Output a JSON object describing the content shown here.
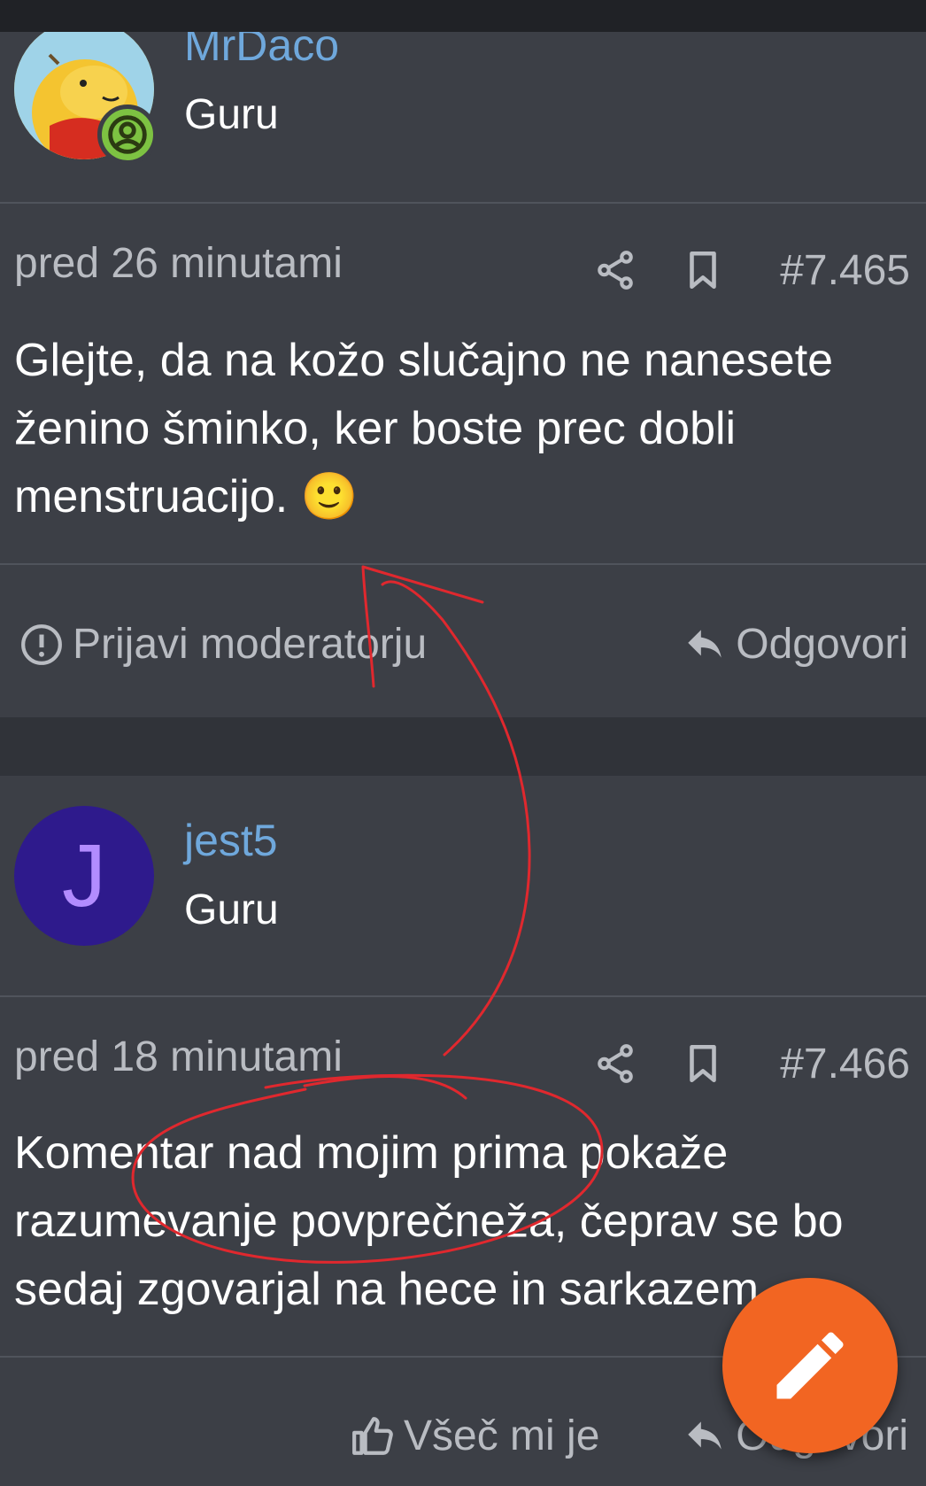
{
  "posts": [
    {
      "username": "MrDaco",
      "rank": "Guru",
      "time": "pred 26 minutami",
      "number": "#7.465",
      "text": "Glejte, da na kožo slučajno ne nanesete ženino šminko, ker boste prec dobli menstruacijo. 🙂",
      "report_label": "Prijavi moderatorju",
      "reply_label": "Odgovori"
    },
    {
      "username": "jest5",
      "rank": "Guru",
      "avatar_letter": "J",
      "time": "pred 18 minutami",
      "number": "#7.466",
      "text": "Komentar nad mojim prima pokaže razumevanje povprečneža, čeprav se bo sedaj zgovarjal na hece in sarkazem.",
      "like_label": "Všeč mi je",
      "reply_label": "Odgovori"
    }
  ],
  "colors": {
    "background": "#303339",
    "card": "#3c3f46",
    "username": "#6fa8dc",
    "fab": "#f26522",
    "annotation": "#e0282e",
    "avatar_jest5": "#2e1a8c",
    "online_badge": "#7dc242"
  },
  "icons": {
    "share": "share-icon",
    "bookmark": "bookmark-icon",
    "report": "alert-circle-icon",
    "reply": "reply-icon",
    "like": "thumbs-up-icon",
    "fab": "pencil-icon"
  }
}
